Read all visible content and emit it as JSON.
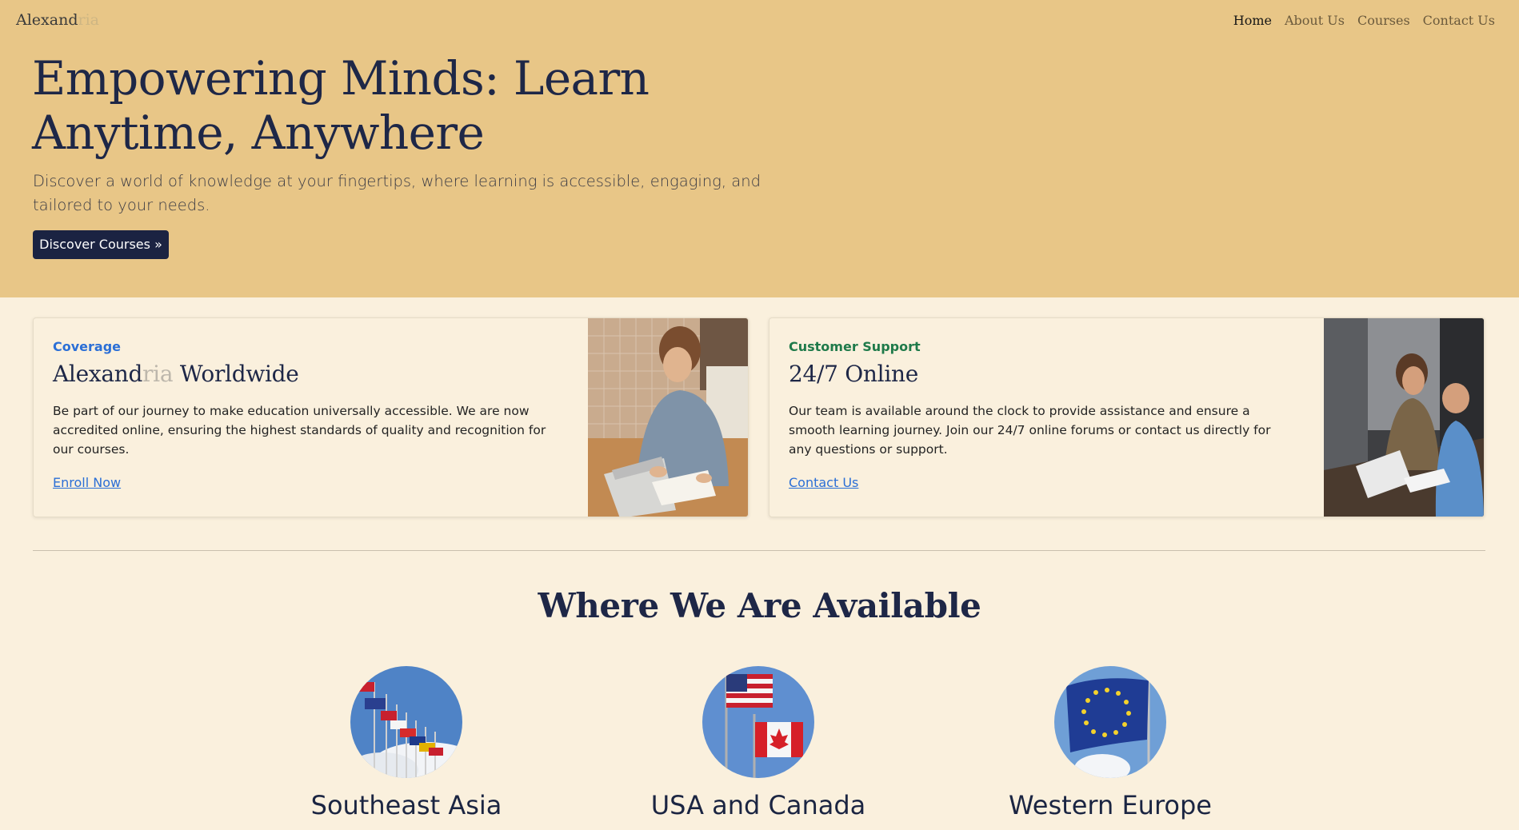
{
  "navbar": {
    "brand_main": "Alexand",
    "brand_fade": "ria",
    "links": [
      "Home",
      "About Us",
      "Courses",
      "Contact Us"
    ],
    "active": "Home"
  },
  "hero": {
    "title": "Empowering Minds: Learn Anytime, Anywhere",
    "subtitle": "Discover a world of knowledge at your fingertips, where learning is accessible, engaging, and tailored to your needs.",
    "button_label": "Discover Courses »"
  },
  "cards": [
    {
      "eyebrow": "Coverage",
      "title_main": "Alexand",
      "title_fade": "ria",
      "title_rest": " Worldwide",
      "text": "Be part of our journey to make education universally accessible. We are now accredited online, ensuring the highest standards of quality and recognition for our courses.",
      "link": "Enroll Now"
    },
    {
      "eyebrow": "Customer Support",
      "title": "24/7 Online",
      "text": "Our team is available around the clock to provide assistance and ensure a smooth learning journey. Join our 24/7 online forums or contact us directly for any questions or support.",
      "link": "Contact Us"
    }
  ],
  "availability": {
    "title": "Where We Are Available",
    "regions": [
      "Southeast Asia",
      "USA and Canada",
      "Western Europe"
    ]
  },
  "colors": {
    "hero_bg": "#e8c687",
    "page_bg": "#faf0dd",
    "navy": "#1b2342",
    "link_blue": "#2b6fd6",
    "support_green": "#1f7a4a"
  }
}
